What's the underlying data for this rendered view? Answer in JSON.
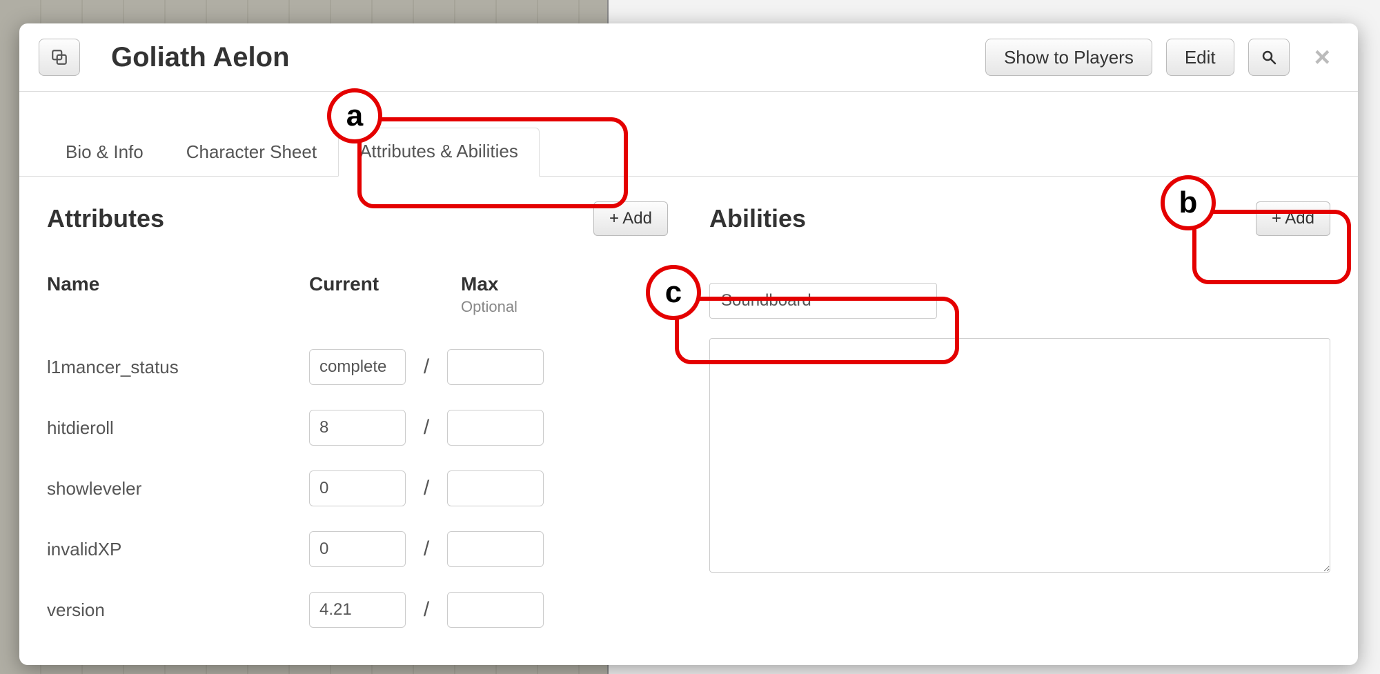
{
  "header": {
    "title": "Goliath Aelon",
    "show_to_players": "Show to Players",
    "edit": "Edit"
  },
  "tabs": [
    {
      "label": "Bio & Info",
      "active": false
    },
    {
      "label": "Character Sheet",
      "active": false
    },
    {
      "label": "Attributes & Abilities",
      "active": true
    }
  ],
  "attributes": {
    "title": "Attributes",
    "add_label": "+ Add",
    "head_name": "Name",
    "head_current": "Current",
    "head_max": "Max",
    "head_max_sub": "Optional",
    "rows": [
      {
        "name": "l1mancer_status",
        "current": "complete",
        "max": ""
      },
      {
        "name": "hitdieroll",
        "current": "8",
        "max": ""
      },
      {
        "name": "showleveler",
        "current": "0",
        "max": ""
      },
      {
        "name": "invalidXP",
        "current": "0",
        "max": ""
      },
      {
        "name": "version",
        "current": "4.21",
        "max": ""
      }
    ]
  },
  "abilities": {
    "title": "Abilities",
    "add_label": "+ Add",
    "name_value": "Soundboard",
    "body_value": ""
  },
  "annotations": {
    "a": "a",
    "b": "b",
    "c": "c"
  }
}
